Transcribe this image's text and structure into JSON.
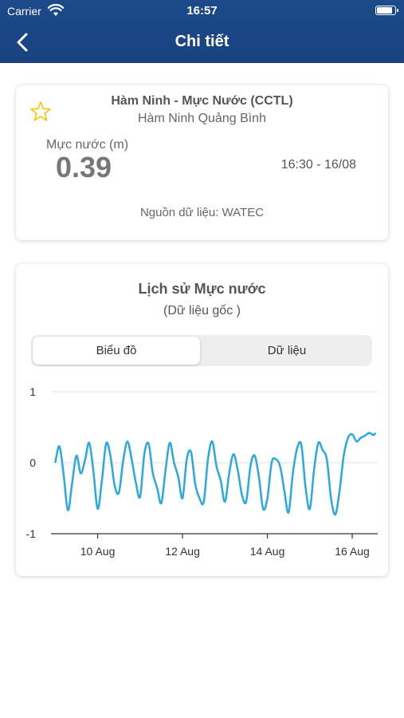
{
  "status_bar": {
    "carrier": "Carrier",
    "time": "16:57",
    "battery_level": 0.9
  },
  "header": {
    "title": "Chi tiết"
  },
  "station": {
    "name": "Hàm Ninh - Mực Nước (CCTL)",
    "location": "Hàm Ninh Quảng Bình",
    "level_label": "Mực nước (m)",
    "level_value": "0.39",
    "time": "16:30 - 16/08",
    "source": "Nguồn dữ liệu: WATEC"
  },
  "history": {
    "title": "Lịch sử Mực nước",
    "subtitle": "(Dữ liệu gốc )",
    "tabs": [
      {
        "label": "Biểu đồ",
        "selected": true
      },
      {
        "label": "Dữ liệu",
        "selected": false
      }
    ]
  },
  "colors": {
    "header": "#1c4a8a",
    "line": "#2aa8e0",
    "star": "#f5c400"
  },
  "chart_data": {
    "type": "line",
    "x_tick_labels": [
      "10 Aug",
      "12 Aug",
      "14 Aug",
      "16 Aug"
    ],
    "x_ticks": [
      10,
      12,
      14,
      16
    ],
    "y_tick_labels": [
      "1",
      "0",
      "-1"
    ],
    "y_ticks": [
      1,
      0,
      -1
    ],
    "ylim": [
      -1,
      1
    ],
    "xlim": [
      8.9,
      16.6
    ],
    "grid": "horizontal",
    "series": [
      {
        "x": [
          9.0,
          9.1,
          9.2,
          9.3,
          9.4,
          9.5,
          9.6,
          9.7,
          9.8,
          9.9,
          10.0,
          10.1,
          10.2,
          10.3,
          10.4,
          10.5,
          10.6,
          10.7,
          10.8,
          10.9,
          11.0,
          11.1,
          11.2,
          11.3,
          11.4,
          11.5,
          11.6,
          11.7,
          11.8,
          11.9,
          12.0,
          12.1,
          12.2,
          12.3,
          12.4,
          12.5,
          12.6,
          12.7,
          12.8,
          12.9,
          13.0,
          13.1,
          13.2,
          13.3,
          13.4,
          13.5,
          13.6,
          13.7,
          13.8,
          13.9,
          14.0,
          14.1,
          14.2,
          14.3,
          14.4,
          14.5,
          14.6,
          14.7,
          14.8,
          14.9,
          15.0,
          15.1,
          15.2,
          15.3,
          15.4,
          15.5,
          15.6,
          15.7,
          15.8,
          15.9,
          16.0,
          16.1,
          16.2,
          16.3,
          16.4,
          16.5,
          16.55
        ],
        "y": [
          0.0,
          0.23,
          -0.18,
          -0.67,
          -0.28,
          0.1,
          -0.15,
          0.03,
          0.28,
          -0.12,
          -0.65,
          -0.25,
          0.27,
          0.1,
          -0.32,
          -0.42,
          0.02,
          0.3,
          0.05,
          -0.28,
          -0.48,
          0.12,
          0.27,
          -0.15,
          -0.35,
          -0.57,
          -0.1,
          0.28,
          0.0,
          -0.2,
          -0.5,
          0.05,
          0.15,
          -0.3,
          -0.5,
          -0.55,
          0.05,
          0.3,
          -0.05,
          -0.25,
          -0.55,
          -0.15,
          0.12,
          -0.1,
          -0.45,
          -0.55,
          -0.05,
          0.1,
          -0.2,
          -0.65,
          -0.5,
          0.0,
          0.05,
          -0.05,
          -0.4,
          -0.7,
          -0.15,
          0.2,
          0.25,
          -0.35,
          -0.65,
          -0.1,
          0.28,
          0.18,
          0.05,
          -0.5,
          -0.73,
          -0.4,
          0.1,
          0.35,
          0.4,
          0.3,
          0.35,
          0.38,
          0.42,
          0.39,
          0.42
        ]
      }
    ]
  }
}
